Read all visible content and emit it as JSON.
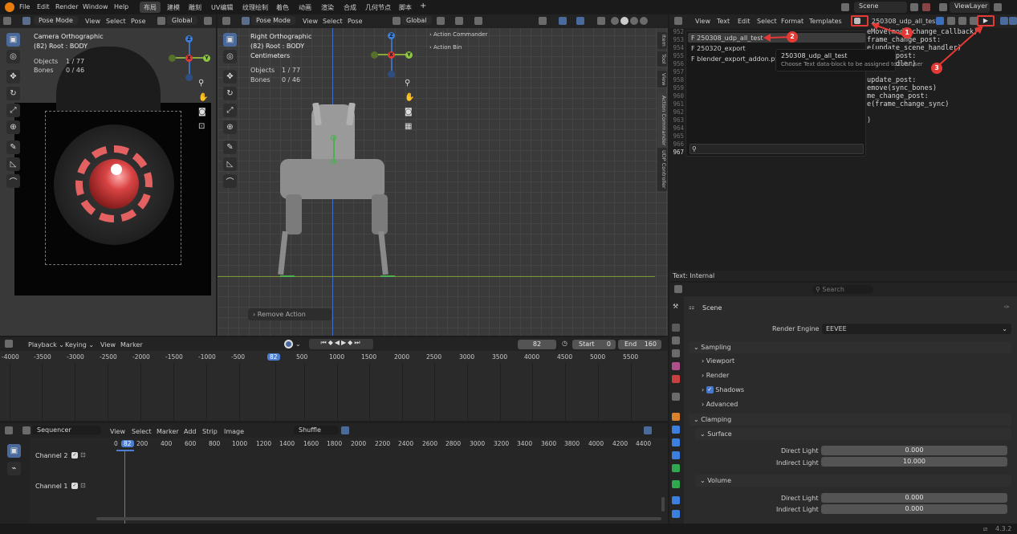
{
  "topbar": {
    "menus": [
      "File",
      "Edit",
      "Render",
      "Window",
      "Help"
    ],
    "workspaces": [
      "布局",
      "建模",
      "雕刻",
      "UV编辑",
      "纹理绘制",
      "着色",
      "动画",
      "渲染",
      "合成",
      "几何节点",
      "脚本"
    ],
    "add_symbol": "+",
    "scene": "Scene",
    "viewlayer": "ViewLayer"
  },
  "cam_view": {
    "mode": "Pose Mode",
    "menus": [
      "View",
      "Select",
      "Pose"
    ],
    "orientation": "Global",
    "title": "Camera Orthographic",
    "subtitle": "(82) Root : BODY",
    "stats": [
      {
        "label": "Objects",
        "value": "1 / 77"
      },
      {
        "label": "Bones",
        "value": "0 / 46"
      }
    ]
  },
  "right_view": {
    "mode": "Pose Mode",
    "menus": [
      "View",
      "Select",
      "Pose"
    ],
    "orientation": "Global",
    "title": "Right Orthographic",
    "subtitle": "(82) Root : BODY",
    "units": "Centimeters",
    "stats": [
      {
        "label": "Objects",
        "value": "1 / 77"
      },
      {
        "label": "Bones",
        "value": "0 / 46"
      }
    ],
    "panels": [
      "Action Commander",
      "Action Bin"
    ],
    "remove_action": "Remove Action",
    "side_tabs": [
      "Item",
      "Tool",
      "View",
      "Action Commander",
      "UDP Controller"
    ]
  },
  "text_editor": {
    "menus": [
      "View",
      "Text",
      "Edit",
      "Select",
      "Format",
      "Templates"
    ],
    "text_name": "250308_udp_all_test",
    "line_numbers": [
      "952",
      "953",
      "954",
      "955",
      "956",
      "957",
      "958",
      "959",
      "960",
      "961",
      "962",
      "963",
      "964",
      "965",
      "966",
      "967"
    ],
    "code_lines": [
      "eMove(mode_change_callback)",
      "frame_change_post:",
      "e(update_scene_handler)",
      "update_post:",
      "ate_handler)",
      "",
      "update_post:",
      "emove(sync_bones)",
      "me_change_post:",
      "e(frame_change_sync)",
      "",
      ")",
      "",
      "",
      "",
      ""
    ],
    "dropdown_items": [
      "F 250308_udp_all_test",
      "F 250320_export",
      "F blender_export_addon.py"
    ],
    "tooltip_title": "250308_udp_all_test",
    "tooltip_desc": "Choose Text data-block to be assigned to this user",
    "status": "Text: Internal"
  },
  "annotations": [
    "1",
    "2",
    "3"
  ],
  "properties": {
    "search_placeholder": "Search",
    "scene_label": "Scene",
    "render_engine_label": "Render Engine",
    "render_engine_value": "EEVEE",
    "sampling": "Sampling",
    "viewport": "Viewport",
    "render": "Render",
    "shadows": "Shadows",
    "advanced": "Advanced",
    "clamping": "Clamping",
    "surface": "Surface",
    "volume": "Volume",
    "direct_light": "Direct Light",
    "indirect_light": "Indirect Light",
    "surface_direct": "0.000",
    "surface_indirect": "10.000",
    "volume_direct": "0.000",
    "volume_indirect": "0.000"
  },
  "timeline": {
    "menus": [
      "Playback",
      "Keying",
      "View",
      "Marker"
    ],
    "frame": "82",
    "start_label": "Start",
    "start": "0",
    "end_label": "End",
    "end": "160",
    "ticks": [
      "-4000",
      "-3500",
      "-3000",
      "-2500",
      "-2000",
      "-1500",
      "-1000",
      "-500",
      "82",
      "500",
      "1000",
      "1500",
      "2000",
      "2500",
      "3000",
      "3500",
      "4000",
      "4500",
      "5000",
      "5500"
    ]
  },
  "sequencer": {
    "title": "Sequencer",
    "menus": [
      "View",
      "Select",
      "Marker",
      "Add",
      "Strip",
      "Image"
    ],
    "shuffle": "Shuffle",
    "ticks": [
      "0",
      "82",
      "200",
      "400",
      "600",
      "800",
      "1000",
      "1200",
      "1400",
      "1600",
      "1800",
      "2000",
      "2200",
      "2400",
      "2600",
      "2800",
      "3000",
      "3200",
      "3400",
      "3600",
      "3800",
      "4000",
      "4200",
      "4400"
    ],
    "channels": [
      "Channel 2",
      "Channel 1"
    ]
  },
  "version": "4.3.2",
  "colors": {
    "accent_red": "#e53935",
    "active_blue": "#4a6a9c",
    "playhead": "#4c7fd4"
  }
}
